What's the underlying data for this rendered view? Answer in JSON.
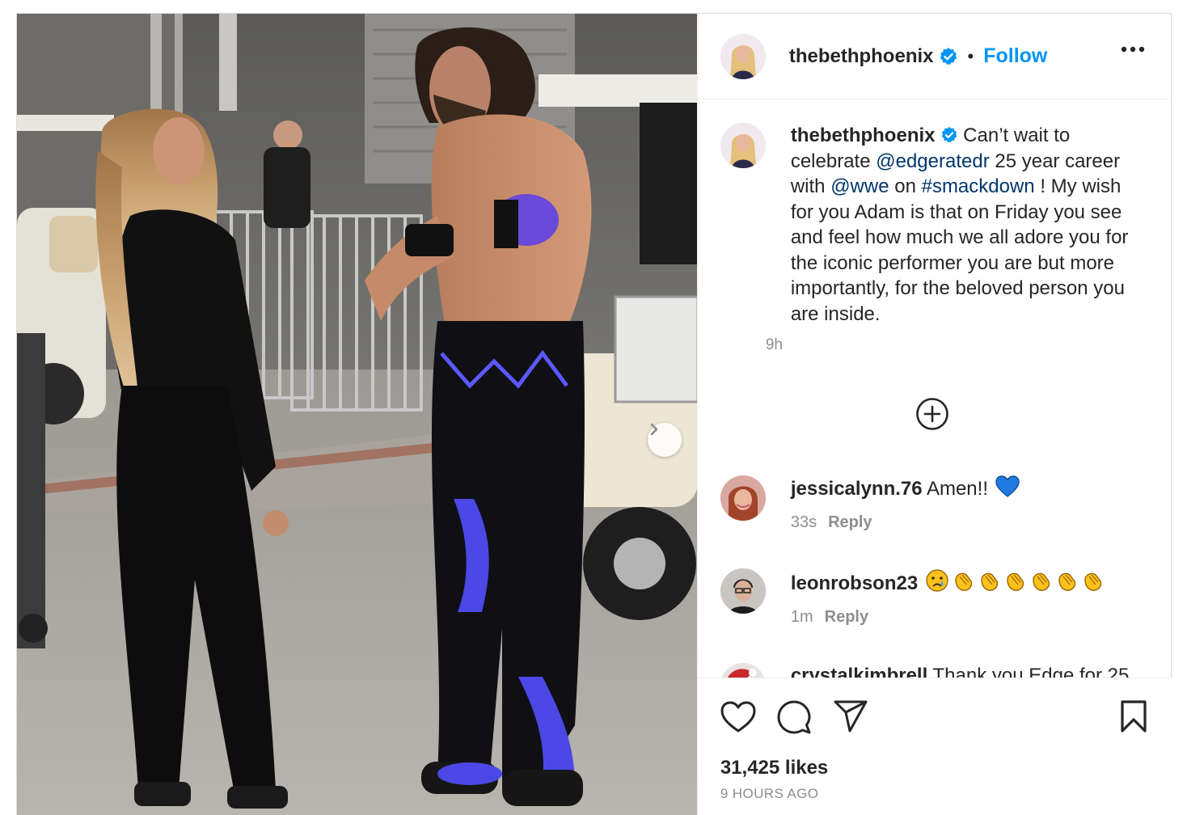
{
  "post": {
    "author": "thebethphoenix",
    "follow_label": "Follow",
    "separator": "•",
    "caption": {
      "username": "thebethphoenix",
      "part1": " Can’t wait to celebrate ",
      "mention1": "@edgeratedr",
      "part2": " 25 year career with ",
      "mention2": "@wwe",
      "part3": " on ",
      "hashtag": "#smackdown",
      "part4": " ! My wish for you Adam is that on Friday you see and feel how much we all adore you for the iconic performer you are but more importantly, for the beloved person you are inside.",
      "time": "9h"
    },
    "comments": [
      {
        "username": "jessicalynn.76",
        "text": "Amen!!",
        "emoji": "blue-heart",
        "time": "33s",
        "reply_label": "Reply"
      },
      {
        "username": "leonrobson23",
        "text": "",
        "emoji": "sad-face + 6 clapping-hands",
        "time": "1m",
        "reply_label": "Reply"
      },
      {
        "username": "crystalkimbrell",
        "text": "Thank you Edge for 25"
      }
    ],
    "likes": "31,425 likes",
    "posted_ago": "9 HOURS AGO"
  },
  "icons": [
    "verified-badge",
    "more-icon",
    "add-circle-icon",
    "heart-icon",
    "comment-icon",
    "share-icon",
    "bookmark-icon",
    "chevron-right-icon"
  ],
  "colors": {
    "accent": "#0095f6",
    "link": "#00376b",
    "muted": "#8e8e8e",
    "verified": "#0095f6"
  }
}
